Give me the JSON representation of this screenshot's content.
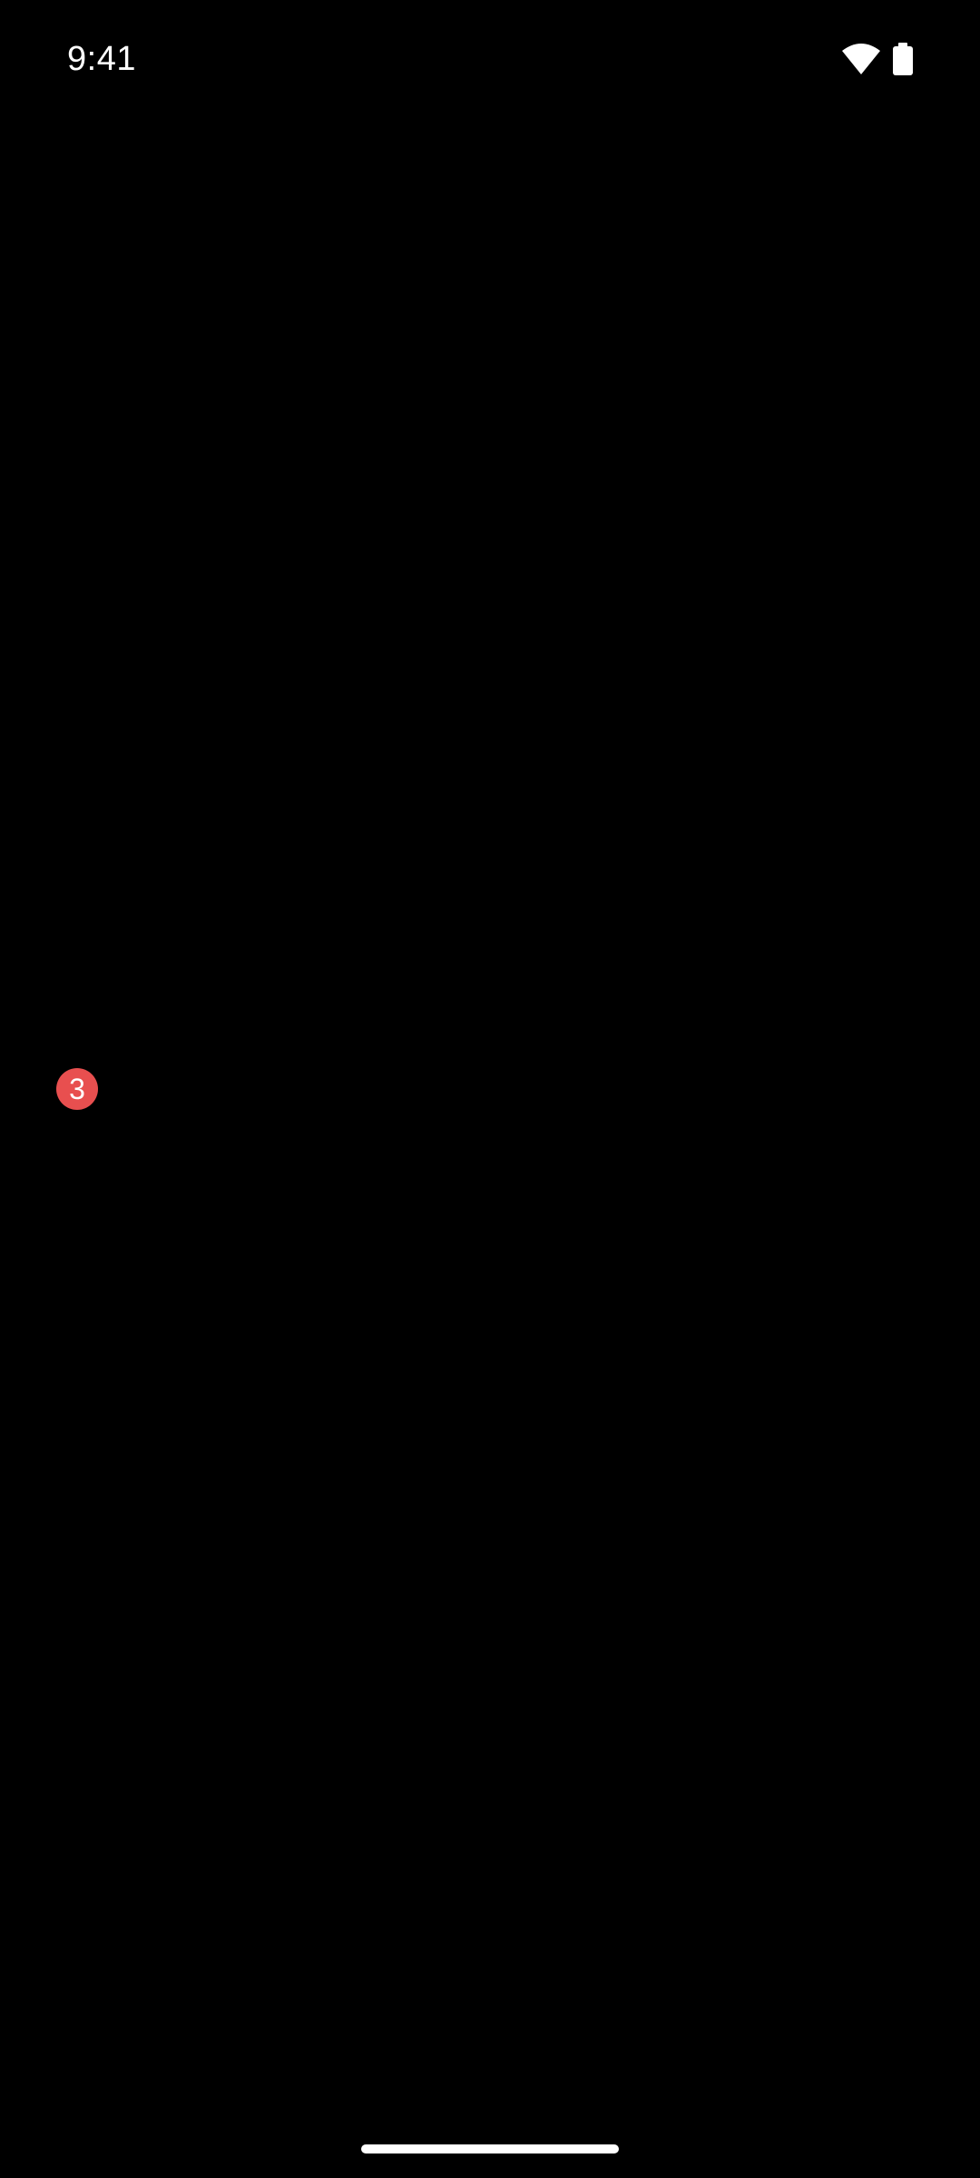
{
  "status_bar": {
    "time": "9:41",
    "icons": [
      "wifi-icon",
      "battery-icon"
    ]
  },
  "badge": {
    "count": "3",
    "color": "#e84f4f"
  },
  "colors": {
    "background": "#000000",
    "foreground": "#ffffff",
    "badge": "#e84f4f"
  }
}
